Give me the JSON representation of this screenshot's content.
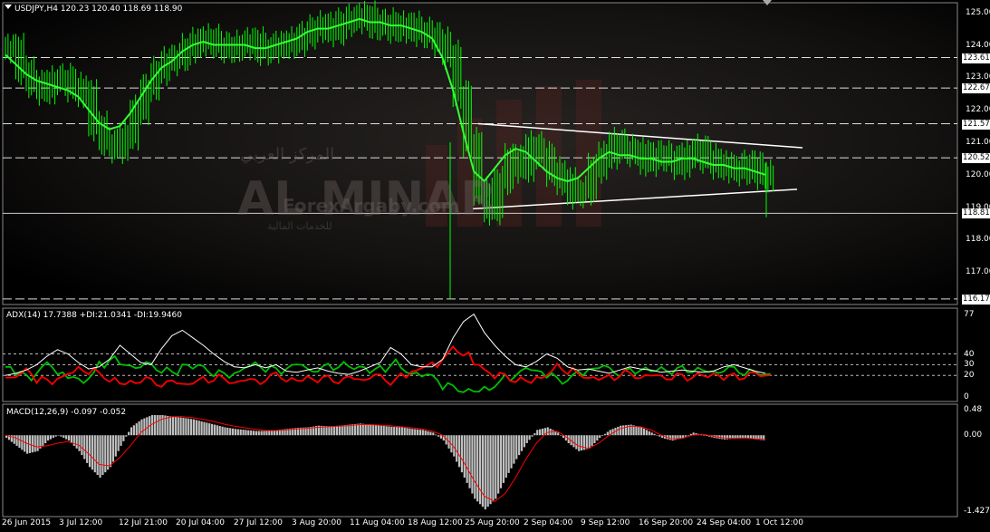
{
  "symbol_header": "USDJPY,H4  120.23 120.40 118.69 118.90",
  "adx_header": "ADX(14) 17.7388 +DI:21.0341 -DI:19.9460",
  "macd_header": "MACD(12,26,9) -0.097 -0.052",
  "watermark": {
    "brand": "AL MINAR",
    "site": "ForexArgaby.com",
    "arabic_top": "المركز العربي",
    "arabic_bottom": "للخدمات المالية"
  },
  "price_axis": {
    "ticks": [
      "125.00",
      "124.00",
      "123.00",
      "122.00",
      "121.00",
      "120.00",
      "119.00",
      "118.00",
      "117.00"
    ],
    "levels": [
      "123.61",
      "122.67",
      "121.57",
      "120.52",
      "118.81",
      "116.17"
    ]
  },
  "adx_axis": [
    "77",
    "40",
    "30",
    "20",
    "0"
  ],
  "macd_axis": [
    "0.48",
    "0.00",
    "-1.427"
  ],
  "time_axis": [
    "26 Jun 2015",
    "3 Jul 12:00",
    "12 Jul 21:00",
    "20 Jul 04:00",
    "27 Jul 12:00",
    "3 Aug 20:00",
    "11 Aug 04:00",
    "18 Aug 12:00",
    "25 Aug 20:00",
    "2 Sep 04:00",
    "9 Sep 12:00",
    "16 Sep 20:00",
    "24 Sep 04:00",
    "1 Oct 12:00"
  ],
  "colors": {
    "background": "#000000",
    "price_bars": "#00ff00",
    "moving_average": "#33ff33",
    "adx_line": "#ffffff",
    "plus_di": "#00c000",
    "minus_di": "#ff0000",
    "macd_hist": "#c0c0c0",
    "macd_signal": "#ff0000"
  },
  "chart_data": [
    {
      "type": "line",
      "title": "USDJPY,H4",
      "series": [
        {
          "name": "close",
          "values": [
            123.9,
            123.2,
            122.8,
            122.6,
            122.9,
            123.0,
            122.7,
            122.5,
            121.5,
            121.0,
            120.8,
            121.2,
            122.0,
            122.7,
            123.2,
            123.5,
            123.6,
            123.9,
            124.1,
            124.2,
            124.0,
            123.9,
            124.0,
            124.1,
            123.8,
            123.9,
            124.0,
            124.1,
            124.3,
            124.5,
            124.6,
            124.4,
            124.7,
            124.8,
            124.9,
            124.6,
            124.7,
            124.5,
            124.6,
            124.4,
            124.3,
            124.1,
            123.7,
            122.5,
            121.0,
            119.5,
            118.9,
            119.8,
            120.5,
            120.2,
            120.9,
            120.6,
            120.1,
            119.8,
            119.4,
            119.5,
            120.2,
            120.6,
            121.0,
            120.8,
            120.7,
            120.4,
            120.6,
            120.5,
            120.3,
            120.6,
            120.8,
            120.5,
            120.3,
            120.2,
            120.1,
            120.3,
            120.0,
            119.9
          ]
        },
        {
          "name": "MA",
          "values": [
            123.7,
            123.4,
            123.1,
            122.9,
            122.8,
            122.7,
            122.6,
            122.4,
            122.0,
            121.6,
            121.4,
            121.5,
            121.9,
            122.4,
            122.9,
            123.3,
            123.5,
            123.8,
            124.0,
            124.1,
            124.0,
            124.0,
            124.0,
            124.0,
            123.9,
            123.9,
            124.0,
            124.1,
            124.2,
            124.4,
            124.5,
            124.5,
            124.6,
            124.7,
            124.8,
            124.7,
            124.7,
            124.6,
            124.6,
            124.5,
            124.4,
            124.2,
            123.6,
            122.6,
            121.3,
            120.1,
            119.8,
            120.2,
            120.6,
            120.8,
            120.7,
            120.4,
            120.1,
            119.9,
            119.8,
            119.9,
            120.2,
            120.5,
            120.7,
            120.6,
            120.6,
            120.5,
            120.5,
            120.4,
            120.4,
            120.5,
            120.5,
            120.4,
            120.3,
            120.3,
            120.2,
            120.2,
            120.1,
            120.0
          ]
        }
      ],
      "ylim": [
        116.0,
        125.3
      ]
    },
    {
      "type": "line",
      "title": "ADX(14) 17.7388 +DI:21.0341 -DI:19.9460",
      "series": [
        {
          "name": "ADX",
          "values": [
            20,
            22,
            25,
            30,
            38,
            44,
            40,
            32,
            26,
            28,
            35,
            48,
            40,
            32,
            30,
            45,
            57,
            62,
            55,
            48,
            40,
            33,
            28,
            27,
            30,
            27,
            30,
            24,
            23,
            25,
            27,
            24,
            22,
            21,
            24,
            28,
            32,
            46,
            40,
            30,
            28,
            28,
            35,
            55,
            70,
            77,
            60,
            48,
            38,
            30,
            28,
            33,
            40,
            36,
            28,
            25,
            26,
            24,
            22,
            25,
            28,
            26,
            25,
            23,
            24,
            25,
            24,
            23,
            24,
            28,
            30,
            27,
            24,
            22
          ]
        },
        {
          "name": "+DI",
          "values": [
            28,
            22,
            18,
            25,
            30,
            22,
            18,
            15,
            20,
            30,
            36,
            30,
            28,
            30,
            28,
            25,
            22,
            30,
            28,
            26,
            22,
            20,
            23,
            28,
            30,
            26,
            24,
            28,
            30,
            25,
            26,
            28,
            30,
            27,
            28,
            24,
            26,
            32,
            25,
            22,
            20,
            18,
            10,
            8,
            6,
            5,
            8,
            12,
            18,
            22,
            26,
            24,
            20,
            15,
            18,
            22,
            26,
            28,
            25,
            22,
            24,
            26,
            24,
            26,
            24,
            26,
            25,
            24,
            23,
            26,
            25,
            23,
            22,
            21
          ]
        },
        {
          "name": "-DI",
          "values": [
            18,
            20,
            24,
            16,
            14,
            18,
            22,
            26,
            24,
            20,
            16,
            12,
            14,
            16,
            14,
            12,
            14,
            12,
            14,
            16,
            18,
            15,
            14,
            16,
            14,
            18,
            20,
            16,
            15,
            18,
            16,
            17,
            15,
            18,
            16,
            19,
            18,
            14,
            20,
            24,
            28,
            30,
            38,
            44,
            40,
            30,
            24,
            20,
            18,
            16,
            14,
            18,
            22,
            28,
            24,
            20,
            18,
            17,
            18,
            22,
            20,
            19,
            20,
            18,
            19,
            18,
            20,
            19,
            21,
            18,
            19,
            20,
            21,
            20
          ]
        }
      ],
      "ylim": [
        0,
        80
      ]
    },
    {
      "type": "bar",
      "title": "MACD(12,26,9) -0.097 -0.052",
      "series": [
        {
          "name": "MACD",
          "values": [
            -0.05,
            -0.2,
            -0.35,
            -0.3,
            -0.1,
            0.0,
            -0.1,
            -0.3,
            -0.6,
            -0.8,
            -0.6,
            -0.2,
            0.15,
            0.3,
            0.38,
            0.38,
            0.35,
            0.33,
            0.3,
            0.25,
            0.2,
            0.15,
            0.12,
            0.1,
            0.08,
            0.08,
            0.1,
            0.12,
            0.14,
            0.15,
            0.18,
            0.17,
            0.18,
            0.2,
            0.22,
            0.2,
            0.18,
            0.16,
            0.15,
            0.12,
            0.1,
            0.05,
            -0.1,
            -0.4,
            -0.8,
            -1.2,
            -1.4,
            -1.2,
            -0.8,
            -0.45,
            -0.15,
            0.1,
            0.15,
            0.05,
            -0.15,
            -0.3,
            -0.25,
            -0.05,
            0.1,
            0.18,
            0.2,
            0.15,
            0.05,
            -0.05,
            -0.1,
            -0.05,
            0.05,
            0.0,
            -0.05,
            -0.08,
            -0.06,
            -0.05,
            -0.08,
            -0.1
          ]
        },
        {
          "name": "Signal",
          "values": [
            0.0,
            -0.05,
            -0.15,
            -0.22,
            -0.2,
            -0.15,
            -0.12,
            -0.18,
            -0.35,
            -0.55,
            -0.58,
            -0.42,
            -0.2,
            0.05,
            0.2,
            0.3,
            0.35,
            0.35,
            0.33,
            0.3,
            0.26,
            0.21,
            0.17,
            0.14,
            0.11,
            0.09,
            0.09,
            0.1,
            0.12,
            0.13,
            0.15,
            0.16,
            0.17,
            0.18,
            0.2,
            0.2,
            0.19,
            0.18,
            0.16,
            0.14,
            0.12,
            0.08,
            0.0,
            -0.2,
            -0.5,
            -0.85,
            -1.15,
            -1.25,
            -1.1,
            -0.8,
            -0.45,
            -0.15,
            0.05,
            0.08,
            -0.05,
            -0.2,
            -0.25,
            -0.15,
            0.0,
            0.12,
            0.17,
            0.16,
            0.1,
            0.0,
            -0.07,
            -0.06,
            0.0,
            0.02,
            -0.02,
            -0.05,
            -0.06,
            -0.05,
            -0.07,
            -0.08
          ]
        }
      ],
      "ylim": [
        -1.45,
        0.5
      ]
    }
  ]
}
